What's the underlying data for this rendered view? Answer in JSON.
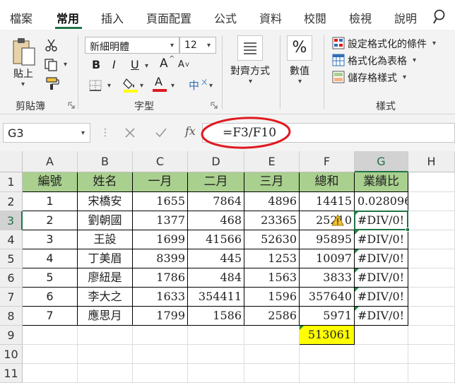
{
  "tabs": [
    "檔案",
    "常用",
    "插入",
    "頁面配置",
    "公式",
    "資料",
    "校閱",
    "檢視",
    "說明"
  ],
  "active_tab": "常用",
  "ribbon": {
    "clipboard": {
      "paste_label": "貼上",
      "group_label": "剪貼簿"
    },
    "font": {
      "font_name": "新細明體",
      "font_size": "12",
      "group_label": "字型",
      "bold": "B",
      "italic": "I",
      "underline": "U",
      "grow": "A",
      "shrink": "A",
      "phonetic": "中"
    },
    "alignment": {
      "label": "對齊方式"
    },
    "number": {
      "label": "數值",
      "symbol": "%"
    },
    "styles": {
      "conditional_format": "設定格式化的條件",
      "format_as_table": "格式化為表格",
      "cell_styles": "儲存格樣式",
      "group_label": "樣式"
    }
  },
  "formula_bar": {
    "name_box": "G3",
    "fx": "fx",
    "formula": "=F3/F10"
  },
  "columns": [
    "A",
    "B",
    "C",
    "D",
    "E",
    "F",
    "G",
    "H"
  ],
  "rows": [
    "1",
    "2",
    "3",
    "4",
    "5",
    "6",
    "7",
    "8",
    "9",
    "10",
    "11"
  ],
  "sheet": {
    "headers": [
      "編號",
      "姓名",
      "一月",
      "二月",
      "三月",
      "總和",
      "業績比"
    ],
    "data": [
      [
        "1",
        "宋橋安",
        "1655",
        "7864",
        "4896",
        "14415",
        "0.028096"
      ],
      [
        "2",
        "劉朝國",
        "1377",
        "468",
        "23365",
        "25210",
        "#DIV/0!"
      ],
      [
        "3",
        "王設",
        "1699",
        "41566",
        "52630",
        "95895",
        "#DIV/0!"
      ],
      [
        "4",
        "丁美眉",
        "8399",
        "445",
        "1253",
        "10097",
        "#DIV/0!"
      ],
      [
        "5",
        "廖紐是",
        "1786",
        "484",
        "1563",
        "3833",
        "#DIV/0!"
      ],
      [
        "6",
        "李大之",
        "1633",
        "354411",
        "1596",
        "357640",
        "#DIV/0!"
      ],
      [
        "7",
        "應思月",
        "1799",
        "1586",
        "2586",
        "5971",
        "#DIV/0!"
      ]
    ],
    "total": "513061"
  },
  "colors": {
    "header_fill": "#a9d08e",
    "total_fill": "#ffff00",
    "accent": "#217346",
    "annotation": "#e0191f"
  }
}
